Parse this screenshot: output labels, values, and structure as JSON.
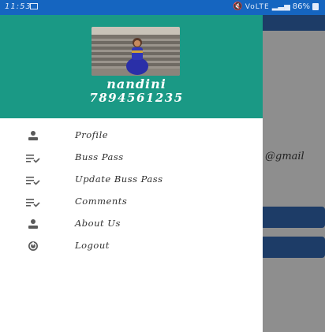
{
  "status_bar": {
    "time": "11:53",
    "signal_text": "VoLTE",
    "battery_text": "86%"
  },
  "drawer": {
    "header": {
      "name": "nandini",
      "phone": "7894561235"
    },
    "menu_items": [
      {
        "label": "Profile",
        "icon": "person-icon"
      },
      {
        "label": "Buss Pass",
        "icon": "list-check-icon"
      },
      {
        "label": "Update Buss Pass",
        "icon": "list-check-icon"
      },
      {
        "label": "Comments",
        "icon": "list-check-icon"
      },
      {
        "label": "About Us",
        "icon": "person-icon"
      },
      {
        "label": "Logout",
        "icon": "power-icon"
      }
    ]
  },
  "background": {
    "email_fragment": "@gmail"
  },
  "colors": {
    "status_bar": "#1565c0",
    "drawer_header": "#1a9985",
    "app_primary": "#1d3c67",
    "scrim": "#8e8e8e"
  }
}
